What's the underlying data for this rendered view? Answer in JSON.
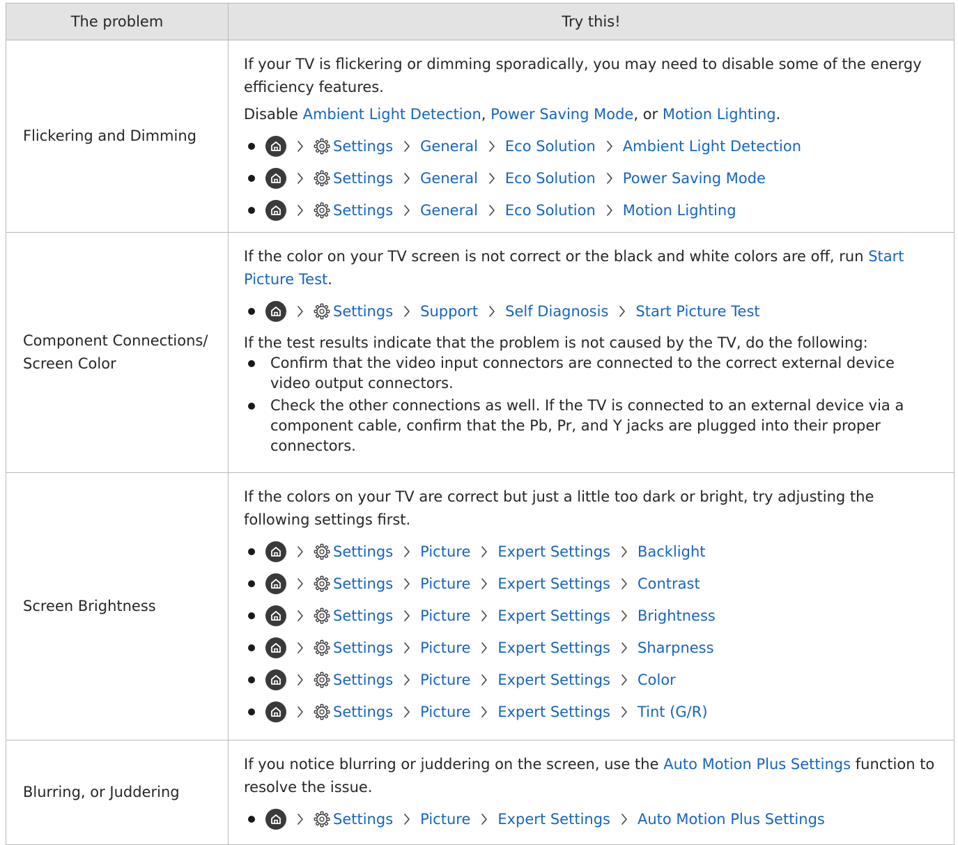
{
  "header": {
    "col_problem": "The problem",
    "col_try": "Try this!"
  },
  "sep": ", ",
  "sep_or": ", or ",
  "period": ".",
  "rows": [
    {
      "problem": "Flickering and Dimming",
      "intro": "If your TV is flickering or dimming sporadically, you may need to disable some of the energy efficiency features.",
      "disable_prefix": "Disable ",
      "disable_links": [
        "Ambient Light Detection",
        "Power Saving Mode",
        "Motion Lighting"
      ],
      "paths": [
        [
          "Settings",
          "General",
          "Eco Solution",
          "Ambient Light Detection"
        ],
        [
          "Settings",
          "General",
          "Eco Solution",
          "Power Saving Mode"
        ],
        [
          "Settings",
          "General",
          "Eco Solution",
          "Motion Lighting"
        ]
      ]
    },
    {
      "problem": "Component Connections/ Screen Color",
      "intro": "If the color on your TV screen is not correct or the black and white colors are off, run ",
      "intro_link": "Start Picture Test",
      "paths": [
        [
          "Settings",
          "Support",
          "Self Diagnosis",
          "Start Picture Test"
        ]
      ],
      "followup": "If the test results indicate that the problem is not caused by the TV, do the following:",
      "bullets": [
        "Confirm that the video input connectors are connected to the correct external device video output connectors.",
        "Check the other connections as well. If the TV is connected to an external device via a component cable, confirm that the Pb, Pr, and Y jacks are plugged into their proper connectors."
      ]
    },
    {
      "problem": "Screen Brightness",
      "intro": "If the colors on your TV are correct but just a little too dark or bright, try adjusting the following settings first.",
      "paths": [
        [
          "Settings",
          "Picture",
          "Expert Settings",
          "Backlight"
        ],
        [
          "Settings",
          "Picture",
          "Expert Settings",
          "Contrast"
        ],
        [
          "Settings",
          "Picture",
          "Expert Settings",
          "Brightness"
        ],
        [
          "Settings",
          "Picture",
          "Expert Settings",
          "Sharpness"
        ],
        [
          "Settings",
          "Picture",
          "Expert Settings",
          "Color"
        ],
        [
          "Settings",
          "Picture",
          "Expert Settings",
          "Tint (G/R)"
        ]
      ]
    },
    {
      "problem": "Blurring, or Juddering",
      "intro": "If you notice blurring or juddering on the screen, use the ",
      "intro_link": "Auto Motion Plus Settings",
      "intro_after": " function to resolve the issue.",
      "paths": [
        [
          "Settings",
          "Picture",
          "Expert Settings",
          "Auto Motion Plus Settings"
        ]
      ]
    }
  ],
  "icons": {
    "home": "home-icon",
    "settings": "gear-icon",
    "separator": "chevron-right-icon",
    "bullet": "bullet-dot"
  },
  "colors": {
    "link": "#1565c0",
    "header_bg": "#e3e3e3",
    "border": "#b8b8b8",
    "text": "#262626"
  }
}
